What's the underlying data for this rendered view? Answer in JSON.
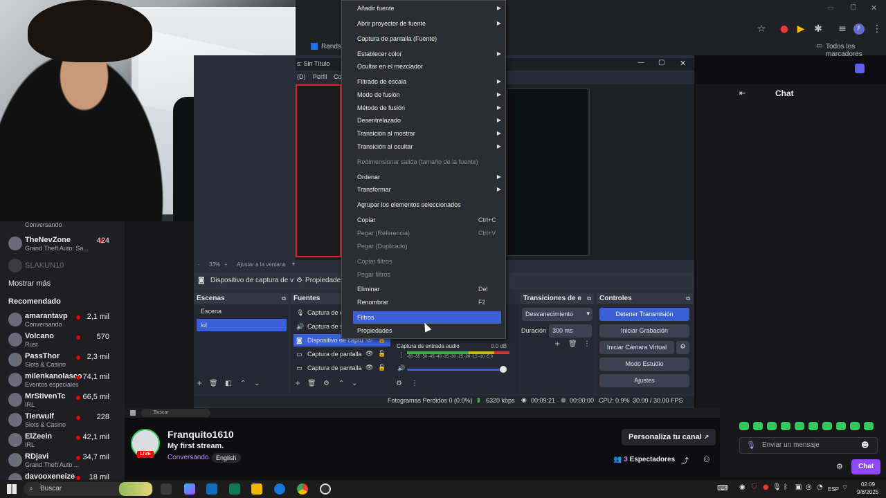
{
  "browser": {
    "bookmark_tab": "Randsta",
    "all_bookmarks": "Todos los marcadores"
  },
  "obs": {
    "title": "s: Sin Título",
    "menu": [
      "(D)",
      "Perfil",
      "Co"
    ],
    "zoom_label": "33%",
    "fit_label": "Ajustar a la ventana",
    "source_bar_device": "Dispositivo de captura de v",
    "source_bar_props": "Propiedades",
    "docks": {
      "scenes": "Escenas",
      "sources": "Fuentes",
      "transitions": "Transiciones de e",
      "controls": "Controles"
    },
    "scenes": [
      "Escena",
      "lol"
    ],
    "sources": [
      {
        "icon": "mic-icon",
        "label": "Captura de e"
      },
      {
        "icon": "speaker-icon",
        "label": "Captura de s"
      },
      {
        "icon": "camera-icon",
        "label": "Dispositivo de captu"
      },
      {
        "icon": "monitor-icon",
        "label": "Captura de pantalla"
      },
      {
        "icon": "monitor-icon",
        "label": "Captura de pantalla"
      }
    ],
    "mixer": {
      "channel": "Captura de entrada audio",
      "db": "0.0 dB",
      "scale": "-60 -55 -50 -45 -40 -35 -30 -25 -20 -15 -10 -5 0"
    },
    "transitions": {
      "type": "Desvanecimiento",
      "duration_label": "Duración",
      "duration_value": "300 ms"
    },
    "controls": {
      "stop_stream": "Detener Transmisión",
      "start_recording": "Iniciar Grabación",
      "virtual_cam": "Iniciar Cámara Virtual",
      "studio_mode": "Modo Estudio",
      "settings": "Ajustes"
    },
    "status": {
      "dropped": "Fotogramas Perdidos 0 (0.0%)",
      "bitrate": "6320 kbps",
      "stream_time": "00:09:21",
      "rec_time": "00:00:00",
      "cpu": "CPU: 0.9%",
      "fps": "30.00 / 30.00 FPS"
    }
  },
  "context_menu": {
    "items": [
      {
        "label": "Añadir fuente",
        "submenu": true
      },
      {
        "label": "Abrir proyector de fuente",
        "submenu": true
      },
      {
        "label": "Captura de pantalla (Fuente)"
      },
      {
        "label": "Establecer color",
        "submenu": true
      },
      {
        "label": "Ocultar en el mezclador"
      },
      {
        "label": "Filtrado de escala",
        "submenu": true
      },
      {
        "label": "Modo de fusión",
        "submenu": true
      },
      {
        "label": "Método de fusión",
        "submenu": true
      },
      {
        "label": "Desentrelazado",
        "submenu": true
      },
      {
        "label": "Transición al mostrar",
        "submenu": true
      },
      {
        "label": "Transición al ocultar",
        "submenu": true
      },
      {
        "label": "Redimensionar salida (tamaño de la fuente)",
        "disabled": true
      },
      {
        "label": "Ordenar",
        "submenu": true
      },
      {
        "label": "Transformar",
        "submenu": true
      },
      {
        "label": "Agrupar los elementos seleccionados"
      },
      {
        "label": "Copiar",
        "shortcut": "Ctrl+C"
      },
      {
        "label": "Pegar (Referencia)",
        "shortcut": "Ctrl+V",
        "disabled": true
      },
      {
        "label": "Pegar (Duplicado)",
        "disabled": true
      },
      {
        "label": "Copiar filtros",
        "disabled": true
      },
      {
        "label": "Pegar filtros",
        "disabled": true
      },
      {
        "label": "Eliminar",
        "shortcut": "Del"
      },
      {
        "label": "Renombrar",
        "shortcut": "F2"
      },
      {
        "label": "Filtros",
        "highlighted": true
      },
      {
        "label": "Propiedades"
      }
    ]
  },
  "twitch": {
    "sidebar": {
      "top_partial": {
        "game": "Conversando"
      },
      "channels": [
        {
          "name": "TheNevZone",
          "game": "Grand Theft Auto: Sa...",
          "viewers": "424"
        },
        {
          "name": "SLAKUN10",
          "game": "",
          "viewers": ""
        }
      ],
      "show_more": "Mostrar más",
      "recommended_title": "Recomendado",
      "recommended": [
        {
          "name": "amarantavp",
          "game": "Conversando",
          "viewers": "2,1 mil"
        },
        {
          "name": "Volcano",
          "game": "Rust",
          "viewers": "570"
        },
        {
          "name": "PassThor",
          "game": "Slots & Casino",
          "viewers": "2,3 mil"
        },
        {
          "name": "milenkanolasco",
          "game": "Eventos especiales",
          "viewers": "74,1 mil"
        },
        {
          "name": "MrStivenTc",
          "game": "IRL",
          "viewers": "66,5 mil"
        },
        {
          "name": "Tierwulf",
          "game": "Slots & Casino",
          "viewers": "228"
        },
        {
          "name": "ElZeein",
          "game": "IRL",
          "viewers": "42,1 mil"
        },
        {
          "name": "RDjavi",
          "game": "Grand Theft Auto ...",
          "viewers": "34,7 mil"
        },
        {
          "name": "davooxeneize",
          "game": "",
          "viewers": "18 mil"
        }
      ]
    },
    "chat_title": "Chat",
    "channel": {
      "name": "Franquito1610",
      "title": "My first stream.",
      "category": "Conversando",
      "language": "English",
      "live": "LIVE",
      "customize": "Personaliza tu canal",
      "viewers_count": "3",
      "viewers_label": "Espectadores"
    },
    "chat_input_placeholder": "Enviar un mensaje",
    "chat_button": "Chat"
  },
  "taskbar": {
    "search": "Buscar",
    "lang": "ESP",
    "time": "02:09",
    "date": "9/8/2025"
  },
  "inner_taskbar": {
    "search": "Buscar"
  },
  "colors": {
    "accent_blue": "#3a60d8",
    "twitch_purple": "#9147ff",
    "live_red": "#eb0400"
  }
}
